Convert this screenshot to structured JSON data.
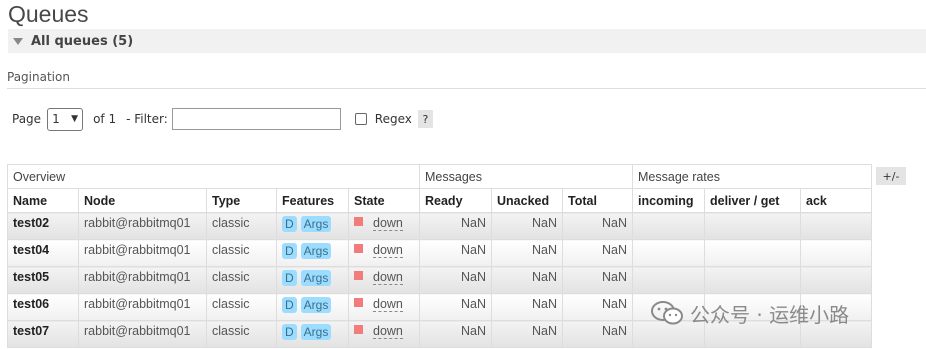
{
  "page": {
    "title": "Queues"
  },
  "section": {
    "label": "All queues (5)"
  },
  "pagination": {
    "label": "Pagination",
    "page_label": "Page",
    "page_value": "1",
    "of_label": "of 1",
    "filter_label": "- Filter:",
    "filter_value": "",
    "regex_label": "Regex",
    "help_label": "?"
  },
  "table": {
    "groups": [
      "Overview",
      "Messages",
      "Message rates"
    ],
    "columns": [
      "Name",
      "Node",
      "Type",
      "Features",
      "State",
      "Ready",
      "Unacked",
      "Total",
      "incoming",
      "deliver / get",
      "ack"
    ],
    "rows": [
      {
        "name": "test02",
        "node": "rabbit@rabbitmq01",
        "type": "classic",
        "features": [
          "D",
          "Args"
        ],
        "state": "down",
        "ready": "NaN",
        "unacked": "NaN",
        "total": "NaN",
        "incoming": "",
        "deliver": "",
        "ack": ""
      },
      {
        "name": "test04",
        "node": "rabbit@rabbitmq01",
        "type": "classic",
        "features": [
          "D",
          "Args"
        ],
        "state": "down",
        "ready": "NaN",
        "unacked": "NaN",
        "total": "NaN",
        "incoming": "",
        "deliver": "",
        "ack": ""
      },
      {
        "name": "test05",
        "node": "rabbit@rabbitmq01",
        "type": "classic",
        "features": [
          "D",
          "Args"
        ],
        "state": "down",
        "ready": "NaN",
        "unacked": "NaN",
        "total": "NaN",
        "incoming": "",
        "deliver": "",
        "ack": ""
      },
      {
        "name": "test06",
        "node": "rabbit@rabbitmq01",
        "type": "classic",
        "features": [
          "D",
          "Args"
        ],
        "state": "down",
        "ready": "NaN",
        "unacked": "NaN",
        "total": "NaN",
        "incoming": "",
        "deliver": "",
        "ack": ""
      },
      {
        "name": "test07",
        "node": "rabbit@rabbitmq01",
        "type": "classic",
        "features": [
          "D",
          "Args"
        ],
        "state": "down",
        "ready": "NaN",
        "unacked": "NaN",
        "total": "NaN",
        "incoming": "",
        "deliver": "",
        "ack": ""
      }
    ],
    "toggle_label": "+/-"
  },
  "watermark": {
    "text": "公众号 · 运维小路",
    "icon": "wechat-icon"
  },
  "colors": {
    "state_down": "#f27c7c",
    "feature_badge": "#9cdcff",
    "header_bg": "#f1f1f1"
  }
}
